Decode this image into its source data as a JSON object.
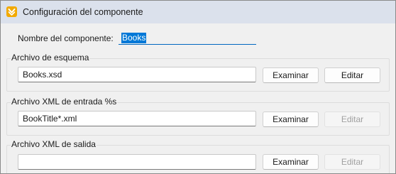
{
  "window": {
    "title": "Configuración del componente",
    "icon": "altova-app-icon"
  },
  "component_name": {
    "label": "Nombre del componente:",
    "value": "Books"
  },
  "schema_file": {
    "label": "Archivo de esquema",
    "value": "Books.xsd",
    "browse_label": "Examinar",
    "edit_label": "Editar",
    "edit_enabled": true
  },
  "input_xml": {
    "label": "Archivo XML de entrada %s",
    "value": "BookTitle*.xml",
    "browse_label": "Examinar",
    "edit_label": "Editar",
    "edit_enabled": false
  },
  "output_xml": {
    "label": "Archivo XML de salida",
    "value": "",
    "browse_label": "Examinar",
    "edit_label": "Editar",
    "edit_enabled": false
  }
}
